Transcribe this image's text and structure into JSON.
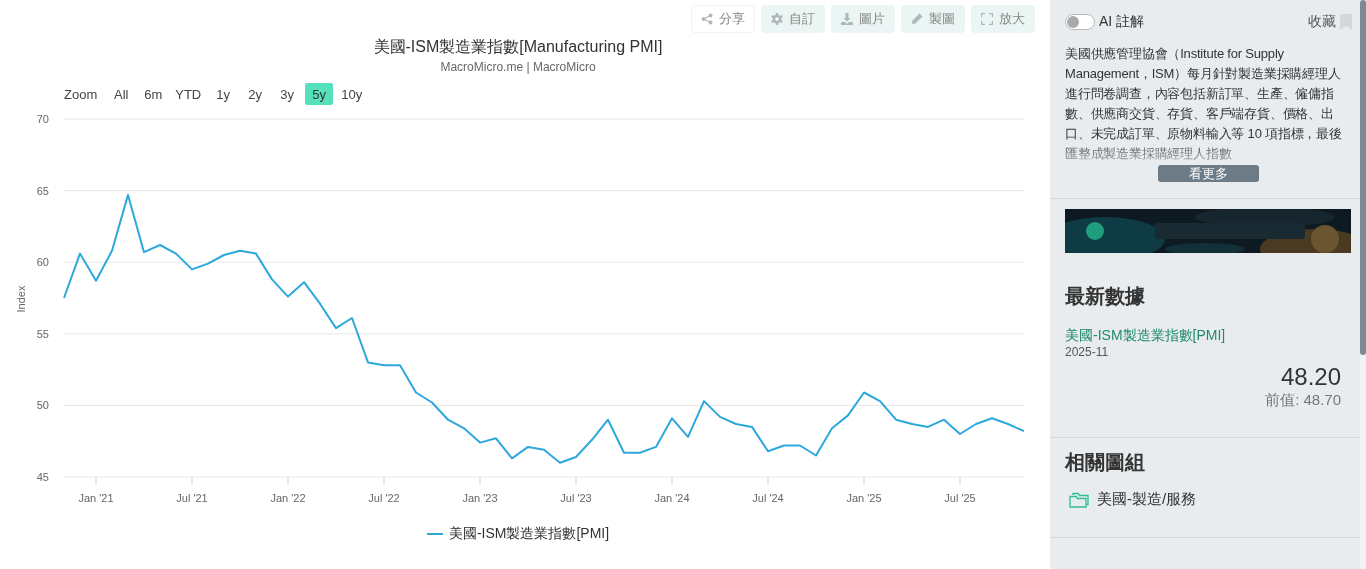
{
  "toolbar": [
    {
      "label": "分享",
      "kind": "share",
      "disabled": true
    },
    {
      "label": "自訂",
      "kind": "gear",
      "disabled": true
    },
    {
      "label": "圖片",
      "kind": "download",
      "disabled": true
    },
    {
      "label": "製圖",
      "kind": "pencil",
      "disabled": true
    },
    {
      "label": "放大",
      "kind": "expand",
      "disabled": true
    }
  ],
  "chart": {
    "title": "美國-ISM製造業指數[Manufacturing PMI]",
    "subtitle": "MacroMicro.me | MacroMicro",
    "range_label": "Zoom",
    "ranges": [
      {
        "label": "All",
        "selected": false
      },
      {
        "label": "6m",
        "selected": false
      },
      {
        "label": "YTD",
        "selected": false
      },
      {
        "label": "1y",
        "selected": false
      },
      {
        "label": "2y",
        "selected": false
      },
      {
        "label": "3y",
        "selected": false
      },
      {
        "label": "5y",
        "selected": true
      },
      {
        "label": "10y",
        "selected": false
      }
    ],
    "chart_data": {
      "type": "line",
      "ylabel": "Index",
      "ylim": [
        45,
        70
      ],
      "yticks": [
        45,
        50,
        55,
        60,
        65,
        70
      ],
      "grid": true,
      "categories": [
        null,
        null,
        "Jan '21",
        null,
        null,
        null,
        null,
        null,
        "Jul '21",
        null,
        null,
        null,
        null,
        null,
        "Jan '22",
        null,
        null,
        null,
        null,
        null,
        "Jul '22",
        null,
        null,
        null,
        null,
        null,
        "Jan '23",
        null,
        null,
        null,
        null,
        null,
        "Jul '23",
        null,
        null,
        null,
        null,
        null,
        "Jan '24",
        null,
        null,
        null,
        null,
        null,
        "Jul '24",
        null,
        null,
        null,
        null,
        null,
        "Jan '25",
        null,
        null,
        null,
        null,
        null,
        "Jul '25",
        null,
        null,
        null,
        null
      ],
      "series": [
        {
          "name": "美國-ISM製造業指數[PMI]",
          "color": "#2ea8dc",
          "values": [
            57.5,
            60.6,
            58.7,
            60.8,
            64.7,
            60.7,
            61.2,
            60.6,
            59.5,
            59.9,
            60.5,
            60.8,
            60.6,
            58.8,
            57.6,
            58.6,
            57.1,
            55.4,
            56.1,
            53.0,
            52.8,
            52.8,
            50.9,
            50.2,
            49.0,
            48.4,
            47.4,
            47.7,
            46.3,
            47.1,
            46.9,
            46.0,
            46.4,
            47.6,
            49.0,
            46.7,
            46.7,
            47.1,
            49.1,
            47.8,
            50.3,
            49.2,
            48.7,
            48.5,
            46.8,
            47.2,
            47.2,
            46.5,
            48.4,
            49.3,
            50.9,
            50.3,
            49.0,
            48.7,
            48.5,
            49.0,
            48.0,
            48.7,
            49.1,
            48.7,
            48.2
          ]
        }
      ]
    }
  },
  "sidebar": {
    "ai_toggle": {
      "label": "AI 註解",
      "on": false
    },
    "bookmark": {
      "label": "收藏"
    },
    "description": "美國供應管理協會（Institute for Supply Management，ISM）每月針對製造業採購經理人進行問卷調查，內容包括新訂單、生產、僱傭指數、供應商交貨、存貨、客戶端存貨、價格、出口、未完成訂單、原物料輸入等 10 項指標，最後匯整成製造業採購經理人指數",
    "more_button": "看更多",
    "latest": {
      "heading": "最新數據",
      "series_name": "美國-ISM製造業指數[PMI]",
      "date": "2025-11",
      "value": "48.20",
      "previous": "前值: 48.70"
    },
    "related_groups": {
      "heading": "相關圖組",
      "items": [
        "美國-製造/服務"
      ]
    }
  }
}
